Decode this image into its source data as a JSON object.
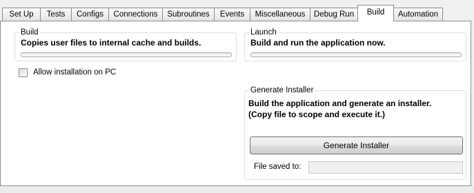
{
  "tabs": [
    {
      "label": "Set Up",
      "active": false
    },
    {
      "label": "Tests",
      "active": false
    },
    {
      "label": "Configs",
      "active": false
    },
    {
      "label": "Connections",
      "active": false
    },
    {
      "label": "Subroutines",
      "active": false
    },
    {
      "label": "Events",
      "active": false
    },
    {
      "label": "Miscellaneous",
      "active": false
    },
    {
      "label": "Debug Run",
      "active": false
    },
    {
      "label": "Build",
      "active": true
    },
    {
      "label": "Automation",
      "active": false
    }
  ],
  "build_group": {
    "title": "Build",
    "description": "Copies user files to internal cache and builds.",
    "progress": 0
  },
  "launch_group": {
    "title": "Launch",
    "description": "Build and run the application now.",
    "progress": 0
  },
  "allow_install": {
    "label": "Allow installation on PC",
    "checked": false
  },
  "installer_group": {
    "title": "Generate Installer",
    "description_line1": "Build the application and generate an installer.",
    "description_line2": "(Copy file to scope and execute it.)",
    "button_label": "Generate Installer",
    "file_saved_label": "File saved to:",
    "file_saved_value": ""
  }
}
